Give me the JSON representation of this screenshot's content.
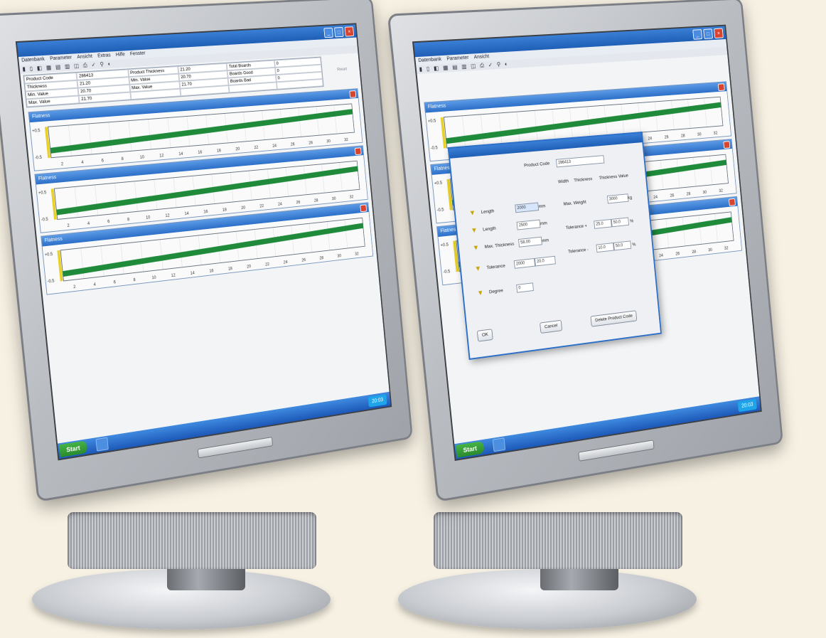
{
  "screen": {
    "app_title": "",
    "menu": [
      "Datenbank",
      "Parameter",
      "Ansicht",
      "Extras",
      "Hilfe",
      "Fenster"
    ],
    "toolbar_glyphs": "▮ ▯ ◧ ▦ ▤ ▥ ◫ ⎙ ✓ ⚲ ◐",
    "info_rows": [
      [
        "Product Code",
        "286413",
        "Product Thickness",
        "21.20",
        "Total Boards",
        "0"
      ],
      [
        "Thickness",
        "21.20",
        "Min. Value",
        "20.70",
        "Boards Good",
        "0"
      ],
      [
        "Min. Value",
        "20.70",
        "Max. Value",
        "21.70",
        "Boards Bad",
        "0"
      ],
      [
        "Max. Value",
        "21.70",
        "",
        "",
        "",
        ""
      ]
    ],
    "side_buttons": [
      "",
      "Reset"
    ],
    "panels": [
      {
        "title": "Flatness",
        "scale_top": "+0.5",
        "scale_bottom": "-0.5"
      },
      {
        "title": "Flatness",
        "scale_top": "+0.5",
        "scale_bottom": "-0.5"
      },
      {
        "title": "Flatness",
        "scale_top": "+0.5",
        "scale_bottom": "-0.5"
      }
    ],
    "x_ticks": [
      "2",
      "4",
      "6",
      "8",
      "10",
      "12",
      "14",
      "16",
      "18",
      "20",
      "22",
      "24",
      "26",
      "28",
      "30",
      "32"
    ],
    "taskbar": {
      "start": "Start",
      "task": "",
      "clock": "20:03"
    }
  },
  "dialog": {
    "title": "",
    "product_code_label": "Product Code",
    "product_code_value": "286413",
    "tabs": [
      "Width",
      "Thickness",
      "Thickness Value"
    ],
    "rows": [
      {
        "label": "Length",
        "value": "2000",
        "unit": "mm"
      },
      {
        "label": "Length",
        "value": "2500",
        "unit": "mm"
      },
      {
        "label": "Max. Thickness",
        "value": "58.00",
        "unit": "mm"
      }
    ],
    "tolerance_label": "Tolerance",
    "tolerance_value": "2000",
    "tolerance_value2": "20.0",
    "right_rows": [
      {
        "label": "Max. Weight",
        "value": "3000",
        "unit": "kg"
      },
      {
        "label": "Tolerance +",
        "value": "25.0",
        "value2": "50.0",
        "unit": "%"
      },
      {
        "label": "Tolerance -",
        "value": "10.0",
        "value2": "50.0",
        "unit": "%"
      }
    ],
    "degree_label": "Degree",
    "degree_value": "0",
    "buttons": {
      "ok": "OK",
      "cancel": "Cancel",
      "delete": "Delete Product Code"
    }
  },
  "colors": {
    "window_blue": "#2c6fc8",
    "chart_green": "#1e8a3a",
    "start_green": "#2a8a2c"
  }
}
